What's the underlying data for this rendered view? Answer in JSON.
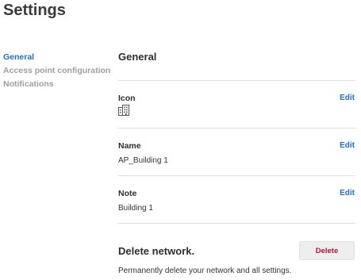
{
  "page": {
    "title": "Settings"
  },
  "sidebar": {
    "items": [
      {
        "label": "General"
      },
      {
        "label": "Access point configuration"
      },
      {
        "label": "Notifications"
      }
    ]
  },
  "general": {
    "title": "General",
    "icon": {
      "label": "Icon",
      "icon_name": "building-icon",
      "edit_label": "Edit"
    },
    "name": {
      "label": "Name",
      "value": "AP_Building 1",
      "edit_label": "Edit"
    },
    "note": {
      "label": "Note",
      "value": "Building 1",
      "edit_label": "Edit"
    }
  },
  "delete": {
    "title": "Delete network.",
    "description": "Permanently delete your network and all settings.",
    "button_label": "Delete"
  },
  "colors": {
    "accent": "#1f6fc4",
    "danger": "#b5123b",
    "muted": "#9e9e9e"
  }
}
